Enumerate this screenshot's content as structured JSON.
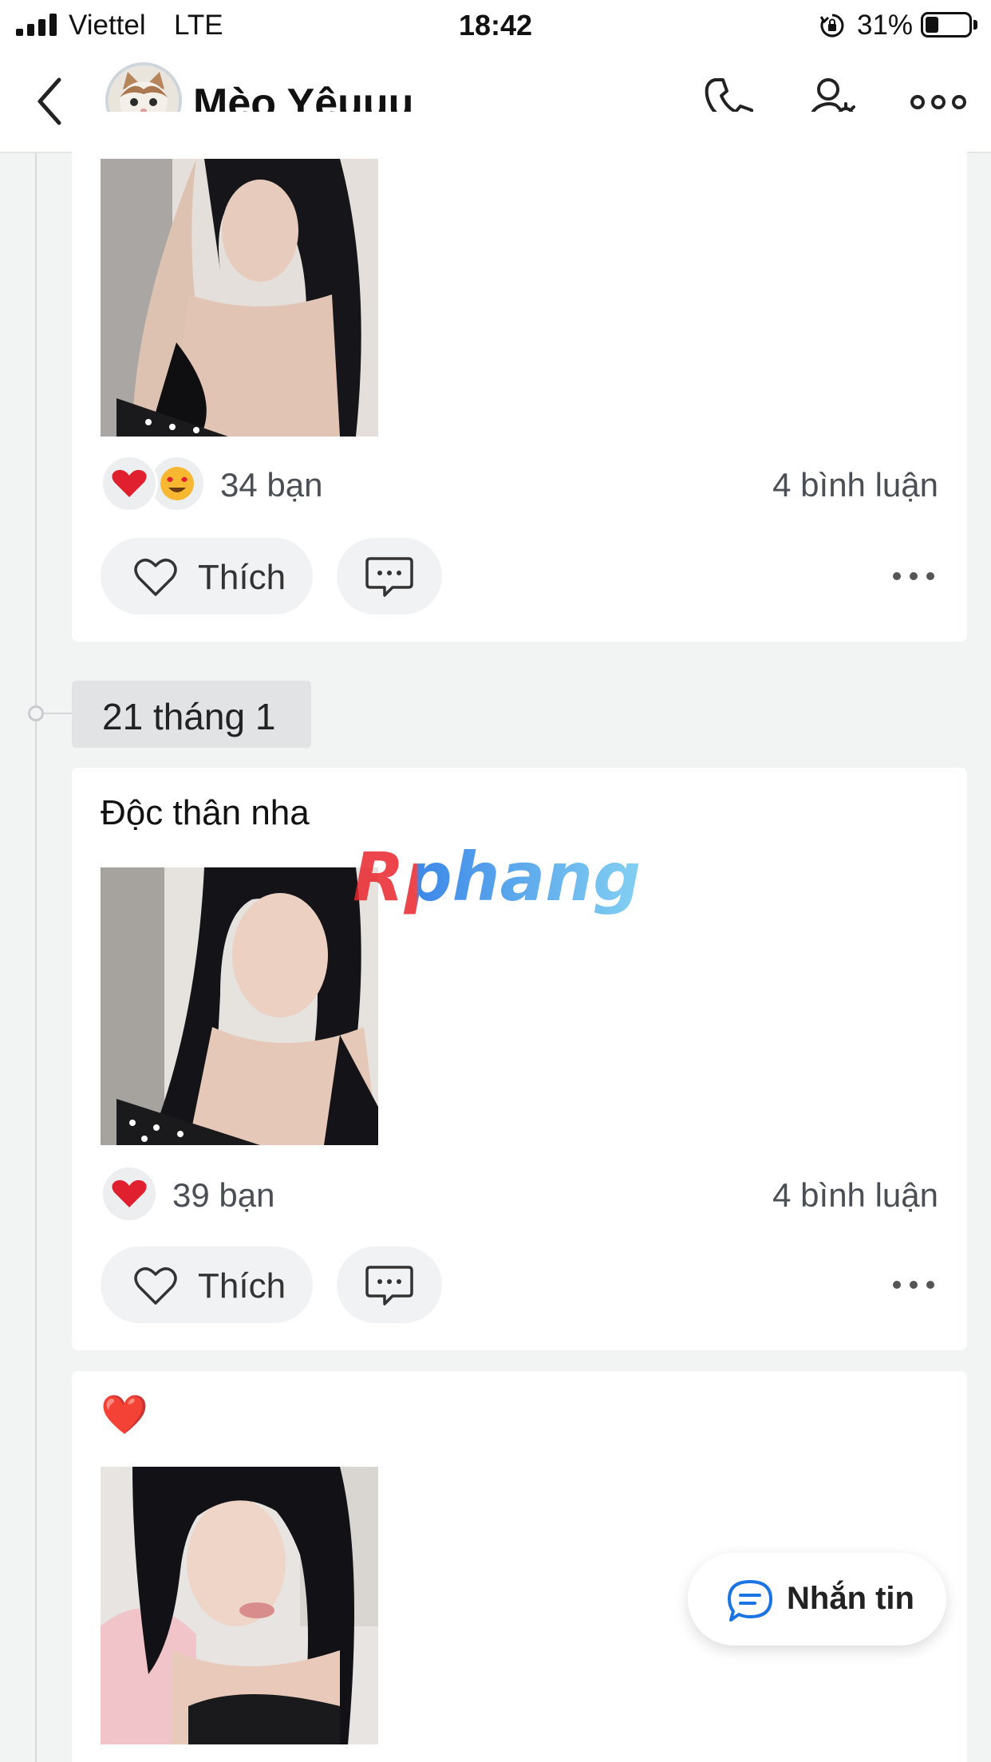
{
  "status_bar": {
    "carrier": "Viettel",
    "network": "LTE",
    "time": "18:42",
    "battery_percent": "31%",
    "battery_level": 0.31
  },
  "header": {
    "title": "Mèo Yêuuu",
    "icons": [
      "back-chevron-icon",
      "phone-icon",
      "user-settings-icon",
      "more-options-icon"
    ]
  },
  "posts": [
    {
      "reactions": [
        "heart-emoji",
        "heart-eyes-emoji"
      ],
      "reaction_count": "34 bạn",
      "comment_count": "4 bình luận",
      "like_label": "Thích"
    },
    {
      "date": "21 tháng 1",
      "text": "Độc thân nha",
      "reactions": [
        "heart-emoji"
      ],
      "reaction_count": "39 bạn",
      "comment_count": "4 bình luận",
      "like_label": "Thích"
    },
    {
      "text_emoji": "❤️"
    }
  ],
  "watermark": "Rphang",
  "fab": {
    "label": "Nhắn tin"
  },
  "colors": {
    "accent_blue": "#1b74e4",
    "heart_red": "#e0202e",
    "background": "#f2f3f3"
  }
}
